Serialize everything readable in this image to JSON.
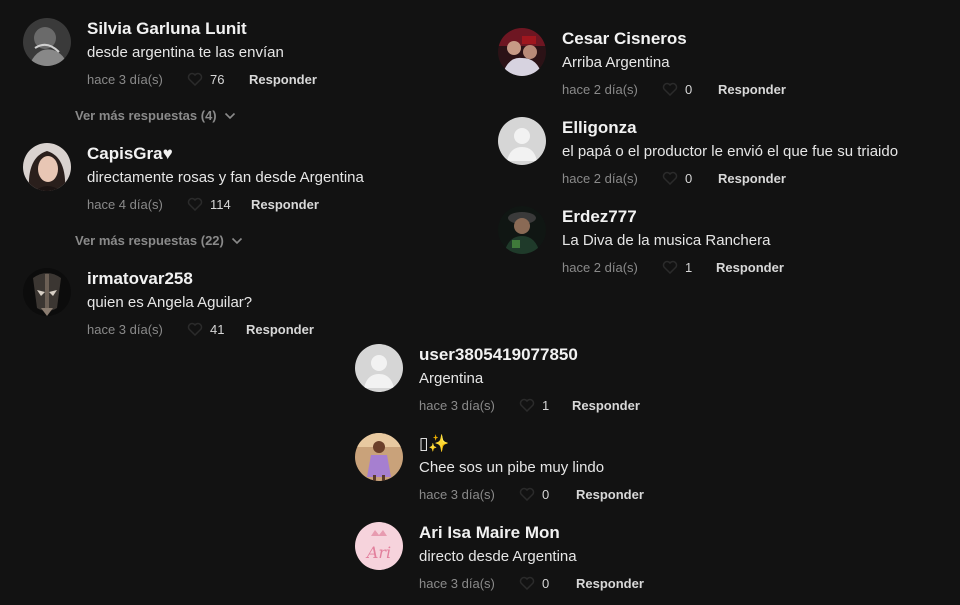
{
  "comments": [
    {
      "user": "Silvia Garluna Lunit",
      "text": "desde argentina te las envían",
      "time": "hace 3 día(s)",
      "likes": "76",
      "reply": "Responder"
    },
    {
      "user": "CapisGra♥",
      "text": "directamente rosas y fan desde Argentina",
      "time": "hace 4 día(s)",
      "likes": "114",
      "reply": "Responder"
    },
    {
      "user": "irmatovar258",
      "text": "quien es Angela Aguilar?",
      "time": "hace 3 día(s)",
      "likes": "41",
      "reply": "Responder"
    },
    {
      "user": "Cesar Cisneros",
      "text": "Arriba Argentina",
      "time": "hace 2 día(s)",
      "likes": "0",
      "reply": "Responder"
    },
    {
      "user": "Elligonza",
      "text": "el papá o el productor le envió el que fue su triaido",
      "time": "hace 2 día(s)",
      "likes": "0",
      "reply": "Responder"
    },
    {
      "user": "Erdez777",
      "text": "La Diva de la musica Ranchera",
      "time": "hace 2 día(s)",
      "likes": "1",
      "reply": "Responder"
    },
    {
      "user": "user3805419077850",
      "text": "Argentina",
      "time": "hace 3 día(s)",
      "likes": "1",
      "reply": "Responder"
    },
    {
      "user": "▯✨",
      "text": "Chee sos un pibe muy lindo",
      "time": "hace 3 día(s)",
      "likes": "0",
      "reply": "Responder"
    },
    {
      "user": "Ari Isa Maire Mon",
      "text": "directo desde Argentina",
      "time": "hace 3 día(s)",
      "likes": "0",
      "reply": "Responder"
    }
  ],
  "more_replies": [
    {
      "label": "Ver más respuestas (4)"
    },
    {
      "label": "Ver más respuestas (22)"
    }
  ],
  "icons": {
    "heart": "heart-outline-icon",
    "chevron": "chevron-down-icon"
  },
  "colors": {
    "background": "#121212",
    "meta": "#8a8a8a",
    "text": "#e6e6e6"
  }
}
